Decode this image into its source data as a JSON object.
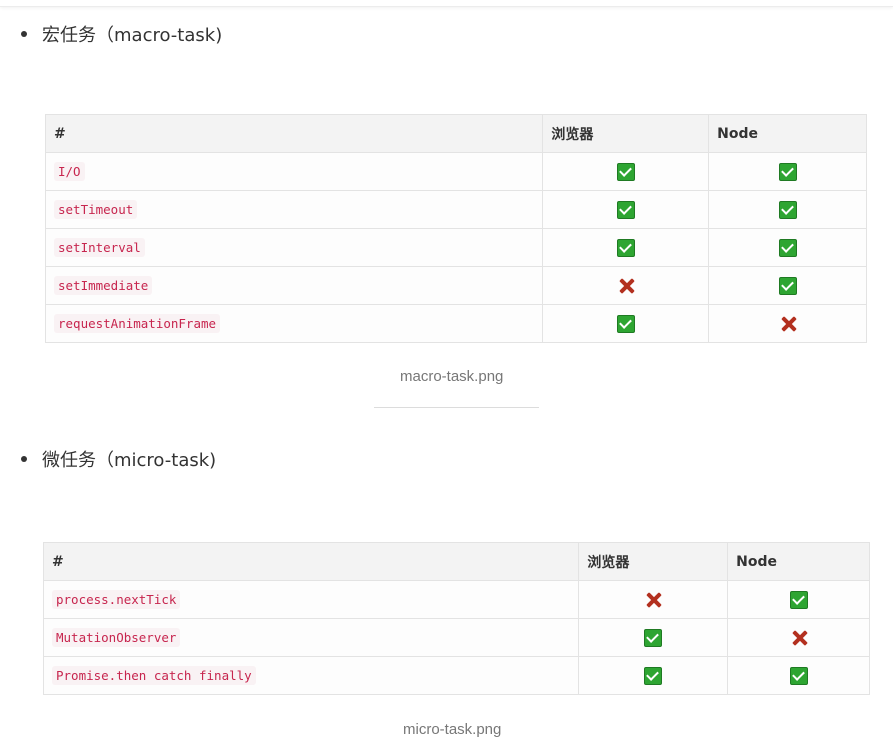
{
  "macro": {
    "heading": "宏任务（macro-task)",
    "headers": [
      "#",
      "浏览器",
      "Node"
    ],
    "rows": [
      {
        "name": "I/O",
        "browser": "check",
        "node": "check"
      },
      {
        "name": "setTimeout",
        "browser": "check",
        "node": "check"
      },
      {
        "name": "setInterval",
        "browser": "check",
        "node": "check"
      },
      {
        "name": "setImmediate",
        "browser": "cross",
        "node": "check"
      },
      {
        "name": "requestAnimationFrame",
        "browser": "check",
        "node": "cross"
      }
    ],
    "caption": "macro-task.png"
  },
  "micro": {
    "heading": "微任务（micro-task)",
    "headers": [
      "#",
      "浏览器",
      "Node"
    ],
    "rows": [
      {
        "name": "process.nextTick",
        "browser": "cross",
        "node": "check"
      },
      {
        "name": "MutationObserver",
        "browser": "check",
        "node": "cross"
      },
      {
        "name": "Promise.then catch finally",
        "browser": "check",
        "node": "check"
      }
    ],
    "caption": "micro-task.png"
  },
  "colors": {
    "check": "#2ea532",
    "cross": "#b3301f",
    "code": "#c7254e"
  }
}
